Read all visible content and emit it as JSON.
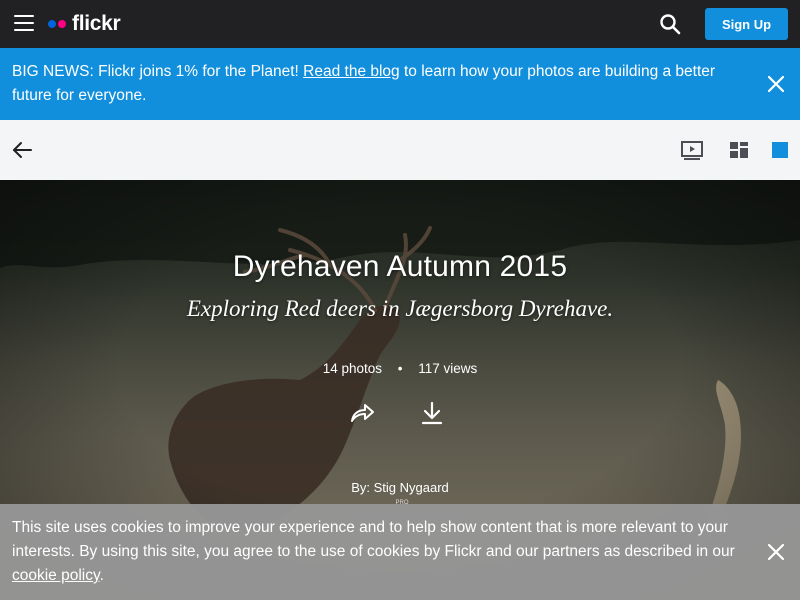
{
  "nav": {
    "logo_text": "flickr",
    "signup_label": "Sign Up",
    "colors": {
      "bar": "#212124",
      "accent": "#128fdc",
      "logo_blue": "#0063dc",
      "logo_pink": "#ff0084"
    }
  },
  "banner": {
    "lead": "BIG NEWS: Flickr joins 1% for the Planet! ",
    "link_text": "Read the blog",
    "trail": " to learn how your photos are building a better future for everyone."
  },
  "toolbar": {
    "views": [
      "slideshow-icon",
      "grid-view-icon",
      "single-view-icon"
    ]
  },
  "album": {
    "title": "Dyrehaven Autumn 2015",
    "subtitle": "Exploring Red deers in Jægersborg Dyrehave.",
    "photos": "14 photos",
    "separator": "•",
    "views": "117 views",
    "byline": "By: Stig Nygaard",
    "badge": "PRO"
  },
  "cookie": {
    "text": "This site uses cookies to improve your experience and to help show content that is more relevant to your interests. By using this site, you agree to the use of cookies by Flickr and our partners as described in our ",
    "link_text": "cookie policy",
    "trail": "."
  }
}
